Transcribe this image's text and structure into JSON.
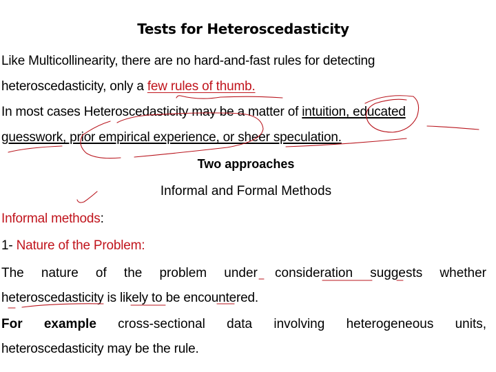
{
  "slide": {
    "title": "Tests for Heteroscedasticity",
    "paragraph1": {
      "line1": "Like Multicollinearity, there are no hard-and-fast rules for detecting",
      "line2_prefix": "heteroscedasticity, only a ",
      "line2_highlight": "few rules of thumb."
    },
    "paragraph2": {
      "line1_prefix": "In most cases Heteroscedasticity may be a matter of ",
      "line1_underlined": "intuition, educated",
      "line2_underlined": "guesswork, prior empirical experience, or sheer speculation."
    },
    "subheading": "Two approaches",
    "subtitle": "Informal and Formal Methods",
    "section_label": "Informal methods",
    "section_label_suffix": ":",
    "item1": {
      "number": "1- ",
      "label": "Nature of the Problem:"
    },
    "item1_body": {
      "line1": "The nature of the problem under consideration suggests whether",
      "line2": "heteroscedasticity is likely to be encountered."
    },
    "example": {
      "bold_prefix": "For example",
      "line1_rest": " cross-sectional data involving heterogeneous units,",
      "line2": "heteroscedasticity may be the rule."
    }
  },
  "colors": {
    "accent_red_text": "#c0141c",
    "annotation_ink": "#b8141c",
    "text": "#000000",
    "background": "#ffffff"
  }
}
